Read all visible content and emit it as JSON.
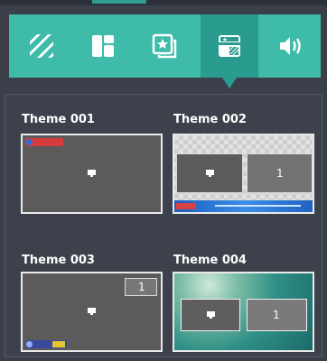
{
  "toolbar": {
    "tools": [
      {
        "name": "pattern-icon"
      },
      {
        "name": "layout-icon"
      },
      {
        "name": "star-frame-icon"
      },
      {
        "name": "theme-icon",
        "active": true
      },
      {
        "name": "speaker-icon"
      }
    ],
    "accent": "#3ebba9",
    "active_color": "#2a9c8f"
  },
  "themes": [
    {
      "title": "Theme 001"
    },
    {
      "title": "Theme 002",
      "box_number": "1"
    },
    {
      "title": "Theme 003",
      "box_number": "1"
    },
    {
      "title": "Theme 004",
      "box_number": "1"
    }
  ]
}
